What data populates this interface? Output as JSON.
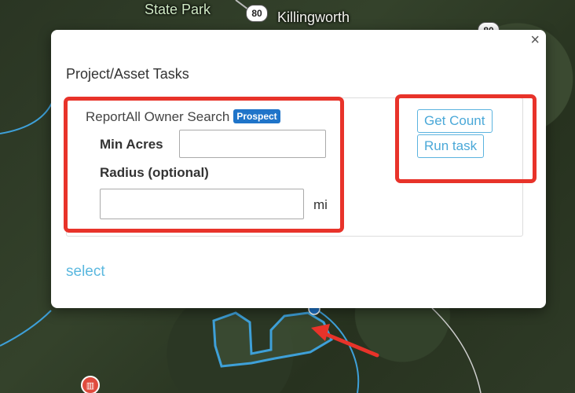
{
  "map": {
    "labels": {
      "state_park": "State Park",
      "killingworth": "Killingworth"
    },
    "route_shields": {
      "primary": "80",
      "secondary": "80"
    },
    "poi_marker_icon": "building-icon",
    "colors": {
      "boundary": "#3ea0d8",
      "annotation": "#e8332a"
    }
  },
  "modal": {
    "close_label": "×",
    "title": "Project/Asset Tasks",
    "task": {
      "name": "ReportAll Owner Search",
      "badge": "Prospect",
      "fields": {
        "min_acres": {
          "label": "Min Acres",
          "value": "",
          "placeholder": ""
        },
        "radius": {
          "label": "Radius (optional)",
          "value": "",
          "placeholder": "",
          "unit": "mi"
        }
      },
      "buttons": {
        "get_count": "Get Count",
        "run_task": "Run task"
      }
    },
    "select_link": "select"
  }
}
